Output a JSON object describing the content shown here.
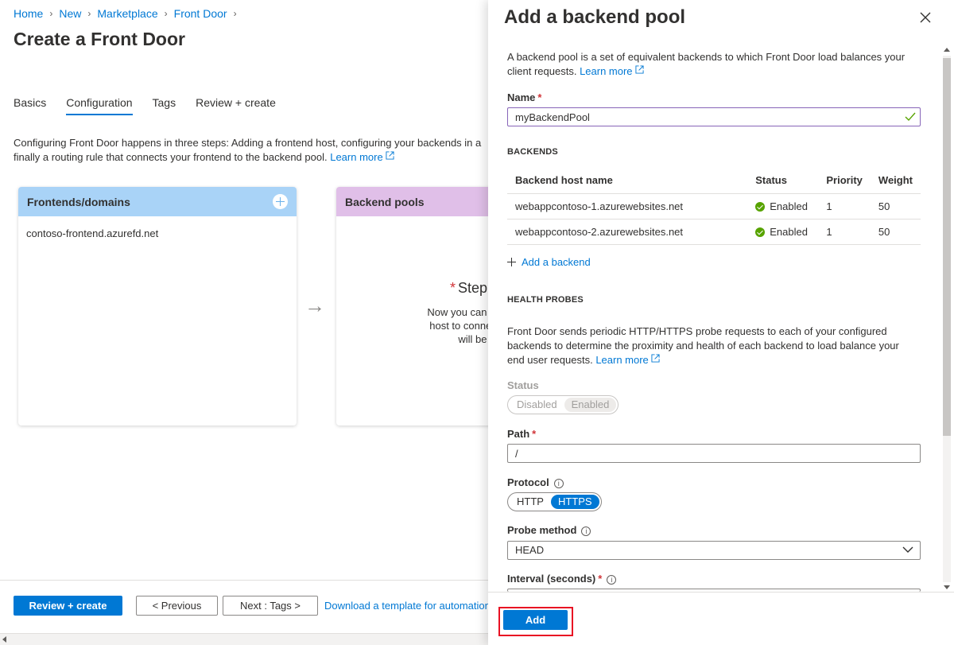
{
  "breadcrumb": {
    "items": [
      "Home",
      "New",
      "Marketplace",
      "Front Door"
    ]
  },
  "page": {
    "title": "Create a Front Door"
  },
  "tabs": [
    {
      "label": "Basics"
    },
    {
      "label": "Configuration",
      "active": true
    },
    {
      "label": "Tags"
    },
    {
      "label": "Review + create"
    }
  ],
  "intro": {
    "line1": "Configuring Front Door happens in three steps: Adding a frontend host, configuring your backends in a",
    "line2": "finally a routing rule that connects your frontend to the backend pool.",
    "learn_more": "Learn more"
  },
  "cards": {
    "frontends": {
      "title": "Frontends/domains",
      "item": "contoso-frontend.azurefd.net"
    },
    "backends": {
      "title": "Backend pools",
      "step_title": "Step",
      "step_desc_line1": "Now you can create a backen",
      "step_desc_line2": "host to connect to. Once you",
      "step_desc_line3": "will be able to cr"
    }
  },
  "footer": {
    "review_create": "Review + create",
    "previous": "< Previous",
    "next": "Next : Tags >",
    "download": "Download a template for automation"
  },
  "panel": {
    "title": "Add a backend pool",
    "description_line1": "A backend pool is a set of equivalent backends to which Front Door load balances your",
    "description_line2": "client requests.",
    "learn_more": "Learn more",
    "name_label": "Name",
    "name_value": "myBackendPool",
    "backends_heading": "BACKENDS",
    "table": {
      "headers": [
        "Backend host name",
        "Status",
        "Priority",
        "Weight"
      ],
      "rows": [
        {
          "host": "webappcontoso-1.azurewebsites.net",
          "status": "Enabled",
          "priority": "1",
          "weight": "50"
        },
        {
          "host": "webappcontoso-2.azurewebsites.net",
          "status": "Enabled",
          "priority": "1",
          "weight": "50"
        }
      ]
    },
    "add_backend": "Add a backend",
    "health_heading": "HEALTH PROBES",
    "health_desc_line1": "Front Door sends periodic HTTP/HTTPS probe requests to each of your configured",
    "health_desc_line2": "backends to determine the proximity and health of each backend to load balance your",
    "health_desc_line3": "end user requests.",
    "health_learn_more": "Learn more",
    "status_label": "Status",
    "status_options": [
      "Disabled",
      "Enabled"
    ],
    "path_label": "Path",
    "path_value": "/",
    "protocol_label": "Protocol",
    "protocol_options": [
      "HTTP",
      "HTTPS"
    ],
    "probe_method_label": "Probe method",
    "probe_method_value": "HEAD",
    "interval_label": "Interval (seconds)",
    "add_button": "Add"
  },
  "colors": {
    "accent": "#0078d4",
    "frontends_header": "#a9d3f7",
    "backends_header": "#e0bfe8",
    "enabled_status": "#57a300",
    "highlight_border": "#e81123"
  }
}
